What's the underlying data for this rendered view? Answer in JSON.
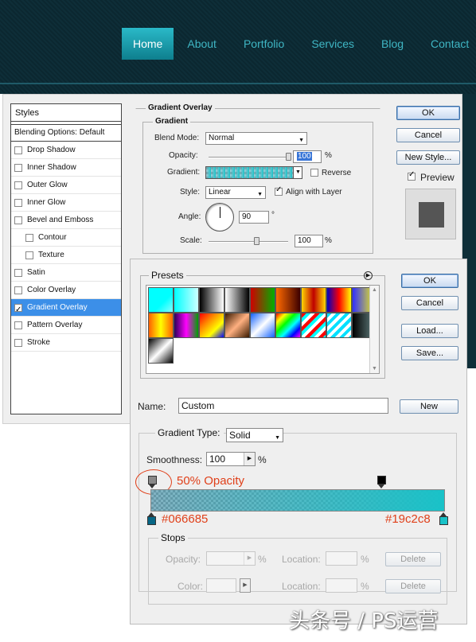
{
  "site_nav": {
    "items": [
      "Home",
      "About",
      "Portfolio",
      "Services",
      "Blog",
      "Contact"
    ],
    "active": "Home"
  },
  "layer_style": {
    "styles_header": "Styles",
    "blending_options": "Blending Options: Default",
    "effects": [
      {
        "label": "Drop Shadow",
        "checked": false,
        "sub": false
      },
      {
        "label": "Inner Shadow",
        "checked": false,
        "sub": false
      },
      {
        "label": "Outer Glow",
        "checked": false,
        "sub": false
      },
      {
        "label": "Inner Glow",
        "checked": false,
        "sub": false
      },
      {
        "label": "Bevel and Emboss",
        "checked": false,
        "sub": false
      },
      {
        "label": "Contour",
        "checked": false,
        "sub": true
      },
      {
        "label": "Texture",
        "checked": false,
        "sub": true
      },
      {
        "label": "Satin",
        "checked": false,
        "sub": false
      },
      {
        "label": "Color Overlay",
        "checked": false,
        "sub": false
      },
      {
        "label": "Gradient Overlay",
        "checked": true,
        "sub": false,
        "selected": true
      },
      {
        "label": "Pattern Overlay",
        "checked": false,
        "sub": false
      },
      {
        "label": "Stroke",
        "checked": false,
        "sub": false
      }
    ],
    "section_title": "Gradient Overlay",
    "group_title": "Gradient",
    "blend_mode_label": "Blend Mode:",
    "blend_mode_value": "Normal",
    "opacity_label": "Opacity:",
    "opacity_value": "100",
    "opacity_percent": 100,
    "percent_sign": "%",
    "gradient_label": "Gradient:",
    "reverse_label": "Reverse",
    "style_label": "Style:",
    "style_value": "Linear",
    "align_label": "Align with Layer",
    "angle_label": "Angle:",
    "angle_value": "90",
    "degree_sign": "°",
    "scale_label": "Scale:",
    "scale_value": "100",
    "scale_percent": 100,
    "buttons": {
      "ok": "OK",
      "cancel": "Cancel",
      "new_style": "New Style...",
      "preview": "Preview"
    }
  },
  "gradient_editor": {
    "presets_label": "Presets",
    "buttons": {
      "ok": "OK",
      "cancel": "Cancel",
      "load": "Load...",
      "save": "Save...",
      "new": "New"
    },
    "name_label": "Name:",
    "name_value": "Custom",
    "gradient_type_label": "Gradient Type:",
    "gradient_type_value": "Solid",
    "smoothness_label": "Smoothness:",
    "smoothness_value": "100",
    "percent_sign": "%",
    "annotation_opacity": "50% Opacity",
    "annotation_left_color": "#066685",
    "annotation_right_color": "#19c2c8",
    "stops_label": "Stops",
    "stops_opacity_label": "Opacity:",
    "stops_color_label": "Color:",
    "stops_location_label": "Location:",
    "delete_label": "Delete",
    "colors": {
      "left": "#066685",
      "right": "#19c2c8",
      "annotation": "#e0401a"
    }
  },
  "watermark": "头条号 / PS运营"
}
